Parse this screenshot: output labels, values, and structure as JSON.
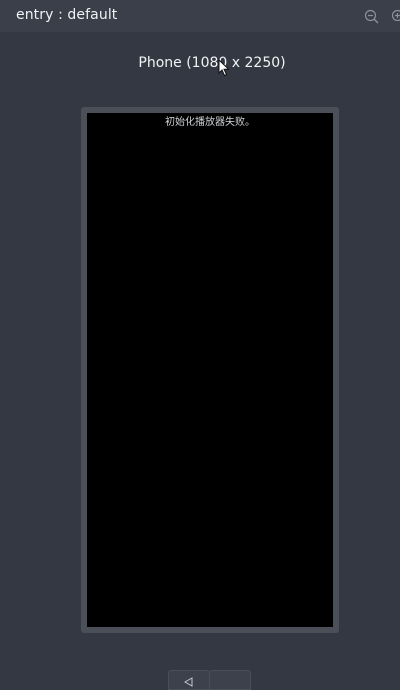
{
  "window": {
    "title": "entry : default"
  },
  "toolbar": {
    "zoom_out_icon": "zoom-out-icon",
    "zoom_in_icon": "zoom-in-icon"
  },
  "device": {
    "label": "Phone (1080 x 2250)"
  },
  "screen": {
    "error_message": "初始化播放器失败。"
  },
  "navigation": {
    "back_icon": "back-triangle-icon",
    "home_icon": "home-icon"
  },
  "colors": {
    "background": "#343842",
    "topbar": "#3b3f49",
    "frame": "#4b4f57",
    "screen": "#000000"
  }
}
